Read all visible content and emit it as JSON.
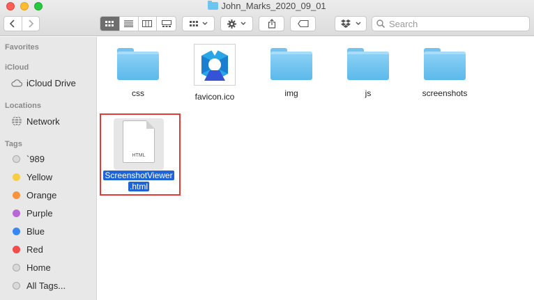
{
  "window": {
    "title": "John_Marks_2020_09_01"
  },
  "toolbar": {
    "search_placeholder": "Search"
  },
  "sidebar": {
    "favorites_header": "Favorites",
    "icloud_header": "iCloud",
    "icloud_drive": "iCloud Drive",
    "locations_header": "Locations",
    "network": "Network",
    "tags_header": "Tags",
    "tags": [
      {
        "label": "`989",
        "color": "#d9d9d9"
      },
      {
        "label": "Yellow",
        "color": "#f8cd46"
      },
      {
        "label": "Orange",
        "color": "#f7943e"
      },
      {
        "label": "Purple",
        "color": "#b967d6"
      },
      {
        "label": "Blue",
        "color": "#3a86f2"
      },
      {
        "label": "Red",
        "color": "#f24c4c"
      },
      {
        "label": "Home",
        "color": "#d9d9d9"
      },
      {
        "label": "All Tags...",
        "color": "#d9d9d9"
      }
    ]
  },
  "files": {
    "css": "css",
    "favicon": "favicon.ico",
    "img": "img",
    "js": "js",
    "screenshots": "screenshots",
    "selected_line1": "ScreenshotViewer",
    "selected_line2": ".html",
    "doc_badge": "HTML"
  }
}
